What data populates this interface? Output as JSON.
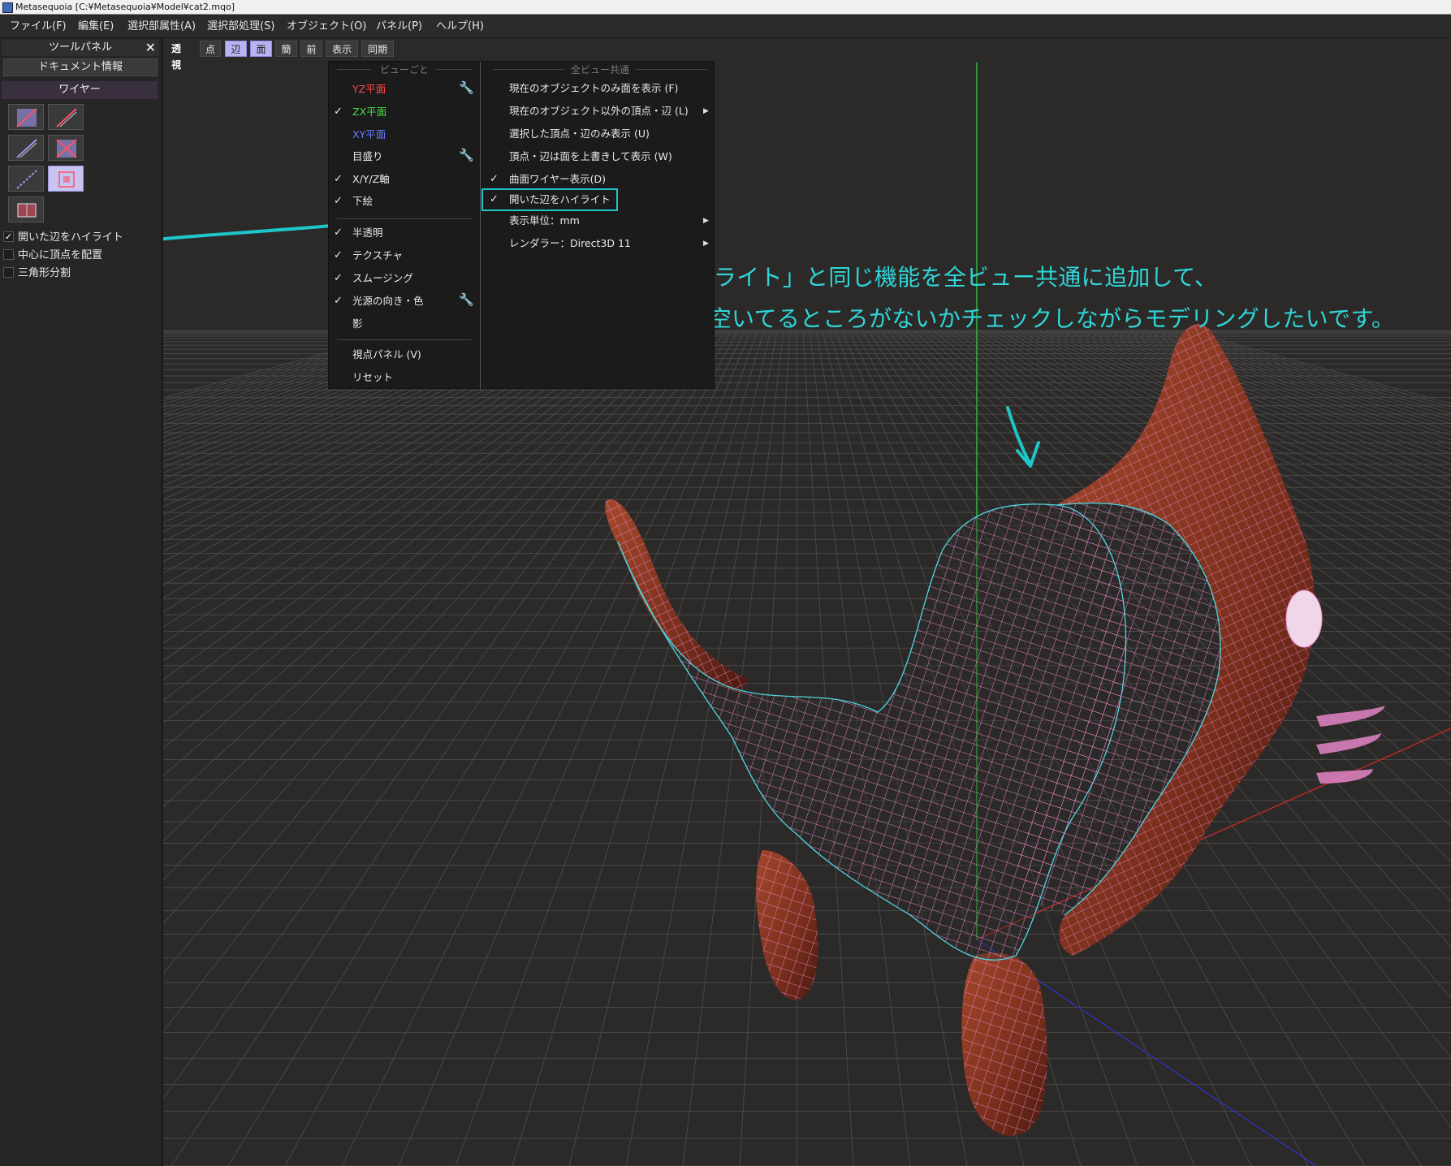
{
  "window": {
    "title": "Metasequoia [C:¥Metasequoia¥Model¥cat2.mqo]"
  },
  "menubar": {
    "items": [
      {
        "label": "ファイル(F)"
      },
      {
        "label": "編集(E)"
      },
      {
        "label": "選択部属性(A)"
      },
      {
        "label": "選択部処理(S)"
      },
      {
        "label": "オブジェクト(O)"
      },
      {
        "label": "パネル(P)"
      },
      {
        "label": "ヘルプ(H)"
      }
    ]
  },
  "toolpanel": {
    "title": "ツールパネル",
    "document_info": "ドキュメント情報",
    "wire_header": "ワイヤー",
    "tool_icons": [
      "wire-diagonal-icon",
      "wire-slash-icon",
      "knife-line-icon",
      "wire-cross-icon",
      "wire-dashed-icon",
      "wire-grid-icon",
      "wire-frame-icon"
    ],
    "options": [
      {
        "label": "開いた辺をハイライト",
        "checked": true
      },
      {
        "label": "中心に頂点を配置",
        "checked": false
      },
      {
        "label": "三角形分割",
        "checked": false
      }
    ]
  },
  "viewbar": {
    "perspective_label": "透視",
    "buttons": [
      {
        "label": "点",
        "active": false
      },
      {
        "label": "辺",
        "active": true
      },
      {
        "label": "面",
        "active": true
      },
      {
        "label": "簡",
        "active": false
      },
      {
        "label": "前",
        "active": false
      },
      {
        "label": "表示",
        "active": false
      },
      {
        "label": "同期",
        "active": false
      }
    ]
  },
  "dropdown": {
    "left_section_title": "ビューごと",
    "right_section_title": "全ビュー共通",
    "left_items": [
      {
        "label": "YZ平面",
        "checked": false,
        "color": "#ff4b4b",
        "wrench": true
      },
      {
        "label": "ZX平面",
        "checked": true,
        "color": "#4bdc4b",
        "wrench": false
      },
      {
        "label": "XY平面",
        "checked": false,
        "color": "#6b7cff",
        "wrench": false
      },
      {
        "label": "目盛り",
        "checked": false,
        "color": "#eaeaea",
        "wrench": true
      },
      {
        "label": "X/Y/Z軸",
        "checked": true,
        "color": "#eaeaea",
        "wrench": false
      },
      {
        "label": "下絵",
        "checked": true,
        "color": "#eaeaea",
        "wrench": false
      },
      {
        "label": "半透明",
        "checked": true,
        "color": "#eaeaea",
        "wrench": false
      },
      {
        "label": "テクスチャ",
        "checked": true,
        "color": "#eaeaea",
        "wrench": false
      },
      {
        "label": "スムージング",
        "checked": true,
        "color": "#eaeaea",
        "wrench": false
      },
      {
        "label": "光源の向き・色",
        "checked": true,
        "color": "#eaeaea",
        "wrench": true
      },
      {
        "label": "影",
        "checked": false,
        "color": "#eaeaea",
        "wrench": false
      },
      {
        "label": "視点パネル (V)",
        "checked": false,
        "color": "#eaeaea",
        "wrench": false
      },
      {
        "label": "リセット",
        "checked": false,
        "color": "#eaeaea",
        "wrench": false
      }
    ],
    "right_items": [
      {
        "label": "現在のオブジェクトのみ面を表示 (F)",
        "checked": false,
        "submenu": false
      },
      {
        "label": "現在のオブジェクト以外の頂点・辺 (L)",
        "checked": false,
        "submenu": true
      },
      {
        "label": "選択した頂点・辺のみ表示 (U)",
        "checked": false,
        "submenu": false
      },
      {
        "label": "頂点・辺は面を上書きして表示 (W)",
        "checked": false,
        "submenu": false
      },
      {
        "label": "曲面ワイヤー表示(D)",
        "checked": true,
        "submenu": false
      },
      {
        "label": "開いた辺をハイライト",
        "checked": true,
        "submenu": false
      },
      {
        "label": "表示単位：mm",
        "checked": false,
        "submenu": true
      },
      {
        "label": "レンダラー：Direct3D 11",
        "checked": false,
        "submenu": true
      }
    ]
  },
  "annotation": {
    "line1": "「開いた辺をハイライト」と同じ機能を全ビュー共通に追加して、",
    "line2": "常にビューで穴が空いてるところがないかチェックしながらモデリングしたいです。",
    "color": "#2fd6d8"
  },
  "colors": {
    "wire": "#f08ad0",
    "open_edge": "#4ed6e0",
    "surface": "#8a3a24",
    "grid": "#4a4846",
    "axis_y": "#2ecc3a",
    "axis_x": "#d22a2a",
    "axis_z": "#2a34c8"
  }
}
